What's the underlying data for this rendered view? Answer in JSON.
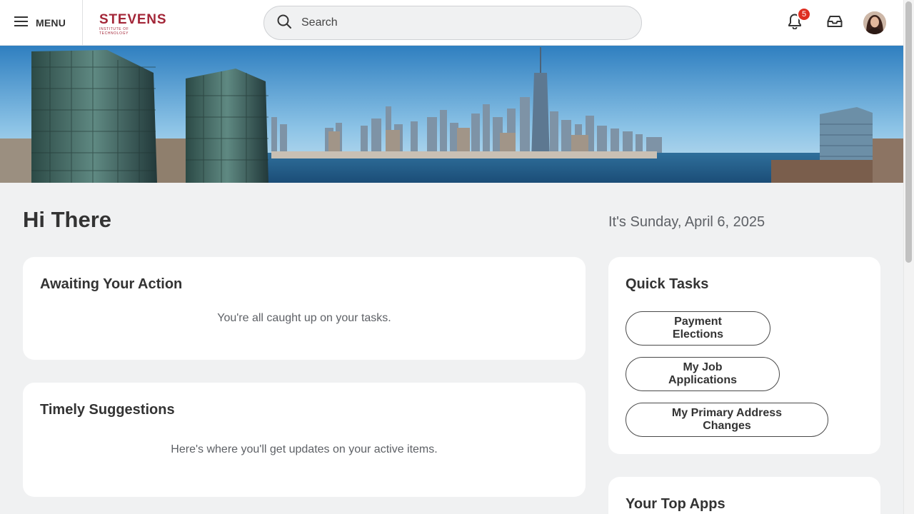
{
  "header": {
    "menu_label": "MENU",
    "logo_word": "STEVENS",
    "logo_sub": "INSTITUTE OF TECHNOLOGY",
    "search_placeholder": "Search",
    "notification_count": "5",
    "icons": [
      "hamburger-icon",
      "search-icon",
      "bell-icon",
      "inbox-icon"
    ]
  },
  "greeting": "Hi There",
  "date_text": "It's Sunday, April 6, 2025",
  "awaiting": {
    "title": "Awaiting Your Action",
    "message": "You're all caught up on your tasks."
  },
  "suggestions": {
    "title": "Timely Suggestions",
    "message": "Here's where you'll get updates on your active items."
  },
  "quick_tasks": {
    "title": "Quick Tasks",
    "items": [
      "Payment Elections",
      "My Job Applications",
      "My Primary Address Changes"
    ]
  },
  "top_apps": {
    "title": "Your Top Apps"
  },
  "colors": {
    "brand": "#a32638",
    "badge": "#de2e21",
    "background": "#f0f1f2"
  }
}
